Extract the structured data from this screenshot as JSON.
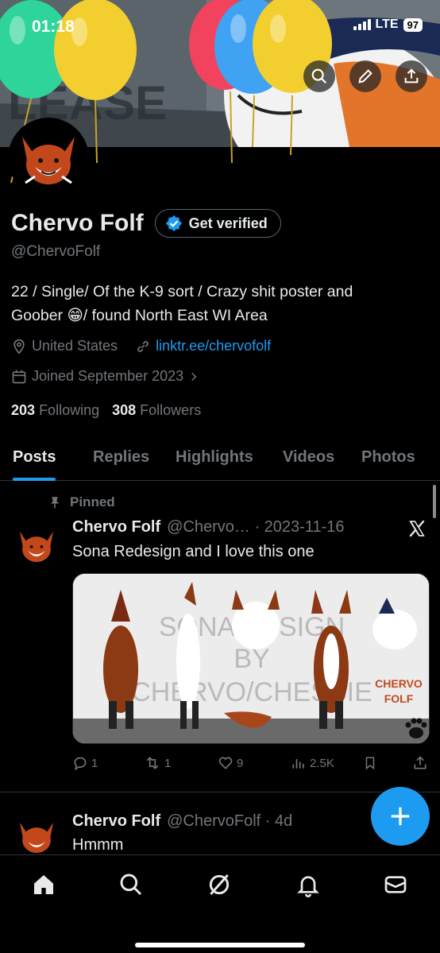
{
  "status_bar": {
    "time": "01:18",
    "network": "LTE",
    "battery": "97"
  },
  "profile": {
    "display_name": "Chervo Folf",
    "verify_label": "Get verified",
    "handle": "@ChervoFolf",
    "bio_line1": "22 / Single/ Of the K-9 sort / Crazy shit poster and",
    "bio_line2": "Goober 😁/ found North East WI Area",
    "location": "United States",
    "link": "linktr.ee/chervofolf",
    "joined": "Joined September 2023",
    "following_count": "203",
    "following_label": "Following",
    "followers_count": "308",
    "followers_label": "Followers"
  },
  "tabs": [
    {
      "label": "Posts",
      "active": true
    },
    {
      "label": "Replies"
    },
    {
      "label": "Highlights"
    },
    {
      "label": "Videos"
    },
    {
      "label": "Photos"
    }
  ],
  "posts": [
    {
      "pinned_label": "Pinned",
      "name": "Chervo Folf",
      "meta": "@Chervo… · 2023-11-16",
      "text": "Sona Redesign and I love this one",
      "image_watermark_1": "SONA DESIGN",
      "image_watermark_2": "BY",
      "image_watermark_3": "CHERVO/CHESSIE",
      "image_caption_1": "CHERVO",
      "image_caption_2": "FOLF",
      "replies": "1",
      "reposts": "1",
      "likes": "9",
      "views": "2.5K"
    },
    {
      "name": "Chervo Folf",
      "meta": "@ChervoFolf · 4d",
      "text": "Hmmm"
    }
  ],
  "colors": {
    "accent": "#1d9bf0",
    "muted": "#71767b",
    "background": "#000000"
  },
  "icons": [
    "search-icon",
    "edit-icon",
    "share-icon",
    "verified-badge-icon",
    "location-icon",
    "link-icon",
    "calendar-icon",
    "pin-icon",
    "reply-icon",
    "repost-icon",
    "like-icon",
    "views-icon",
    "bookmark-icon",
    "home-icon",
    "grok-icon",
    "notifications-icon",
    "messages-icon",
    "compose-icon",
    "x-logo-icon"
  ]
}
